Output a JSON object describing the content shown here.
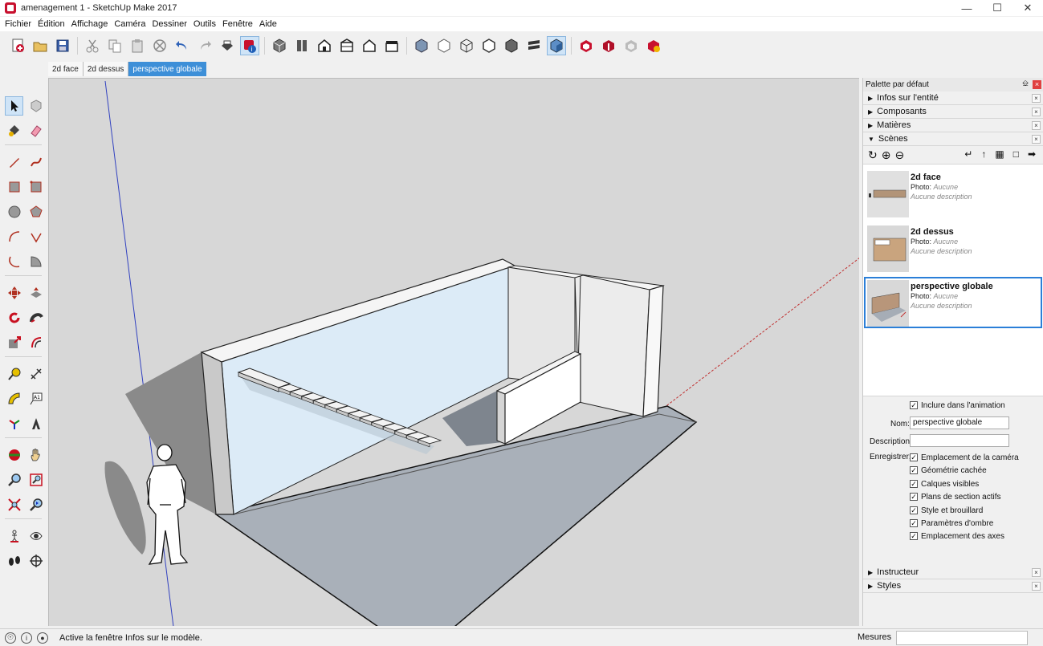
{
  "window": {
    "title": "amenagement 1 - SketchUp Make 2017",
    "controls": [
      "minimize-icon",
      "maximize-icon",
      "close-icon"
    ]
  },
  "menu": [
    "Fichier",
    "Édition",
    "Affichage",
    "Caméra",
    "Dessiner",
    "Outils",
    "Fenêtre",
    "Aide"
  ],
  "toolbar": {
    "groups": [
      [
        "new-file-icon",
        "open-folder-icon",
        "save-icon"
      ],
      [
        "cut-icon",
        "copy-icon",
        "paste-icon",
        "erase-icon",
        "undo-icon",
        "redo-icon",
        "print-icon",
        "model-info-icon"
      ],
      [
        "iso-view-icon",
        "top-view-icon",
        "front-view-icon",
        "right-view-icon",
        "back-view-icon",
        "left-view-icon"
      ],
      [
        "xray-icon",
        "back-edges-icon",
        "wireframe-icon",
        "hidden-line-icon",
        "shaded-icon",
        "shaded-textures-icon",
        "monochrome-icon"
      ],
      [
        "warehouse-icon",
        "share-model-icon",
        "share-component-icon",
        "extension-warehouse-icon"
      ]
    ]
  },
  "scene_tabs": [
    "2d face",
    "2d dessus",
    "perspective globale"
  ],
  "active_scene_tab": "perspective globale",
  "left_tools": [
    [
      "select-arrow-icon",
      "make-component-icon"
    ],
    [
      "paint-bucket-icon",
      "eraser-icon"
    ],
    [
      "pencil-line-icon",
      "freehand-icon"
    ],
    [
      "rectangle-icon",
      "rotated-rectangle-icon"
    ],
    [
      "circle-icon",
      "polygon-icon"
    ],
    [
      "arc-icon",
      "two-point-arc-icon"
    ],
    [
      "three-point-arc-icon",
      "pie-icon"
    ],
    [
      "move-icon",
      "push-pull-icon"
    ],
    [
      "rotate-icon",
      "follow-me-icon"
    ],
    [
      "scale-icon",
      "offset-icon"
    ],
    [
      "tape-measure-icon",
      "dimension-icon"
    ],
    [
      "protractor-icon",
      "text-icon"
    ],
    [
      "axes-icon",
      "3d-text-icon"
    ],
    [
      "orbit-icon",
      "pan-icon"
    ],
    [
      "zoom-icon",
      "zoom-window-icon"
    ],
    [
      "zoom-extents-icon",
      "previous-view-icon"
    ],
    [
      "position-camera-icon",
      "look-around-icon"
    ],
    [
      "walk-icon",
      "section-plane-icon"
    ]
  ],
  "tray": {
    "title": "Palette par défaut",
    "sections_top": [
      {
        "label": "Infos sur l'entité",
        "expanded": false
      },
      {
        "label": "Composants",
        "expanded": false
      },
      {
        "label": "Matières",
        "expanded": false
      },
      {
        "label": "Scènes",
        "expanded": true
      }
    ],
    "scenes": [
      {
        "name": "2d face",
        "photo_label": "Photo:",
        "photo_value": "Aucune",
        "description": "Aucune description",
        "selected": false
      },
      {
        "name": "2d dessus",
        "photo_label": "Photo:",
        "photo_value": "Aucune",
        "description": "Aucune description",
        "selected": false
      },
      {
        "name": "perspective globale",
        "photo_label": "Photo:",
        "photo_value": "Aucune",
        "description": "Aucune description",
        "selected": true
      }
    ],
    "props": {
      "include_anim": "Inclure dans l'animation",
      "name_label": "Nom:",
      "name_value": "perspective globale",
      "desc_label": "Description:",
      "desc_value": "",
      "save_label": "Enregistrer:",
      "save_options": [
        "Emplacement de la caméra",
        "Géométrie cachée",
        "Calques visibles",
        "Plans de section actifs",
        "Style et brouillard",
        "Paramètres d'ombre",
        "Emplacement des axes"
      ]
    },
    "sections_bottom": [
      {
        "label": "Instructeur",
        "expanded": false
      },
      {
        "label": "Styles",
        "expanded": false
      }
    ]
  },
  "status": {
    "message": "Active la fenêtre Infos sur le modèle.",
    "measure_label": "Mesures",
    "measure_value": ""
  },
  "colors": {
    "accent": "#3d8fd8",
    "viewport_bg": "#d7d7d7",
    "wall_inner": "#dcebf7",
    "floor": "#a9b0b9",
    "shadow": "#7e7e7e",
    "axis_red": "#c03030",
    "axis_blue": "#3040c0"
  }
}
